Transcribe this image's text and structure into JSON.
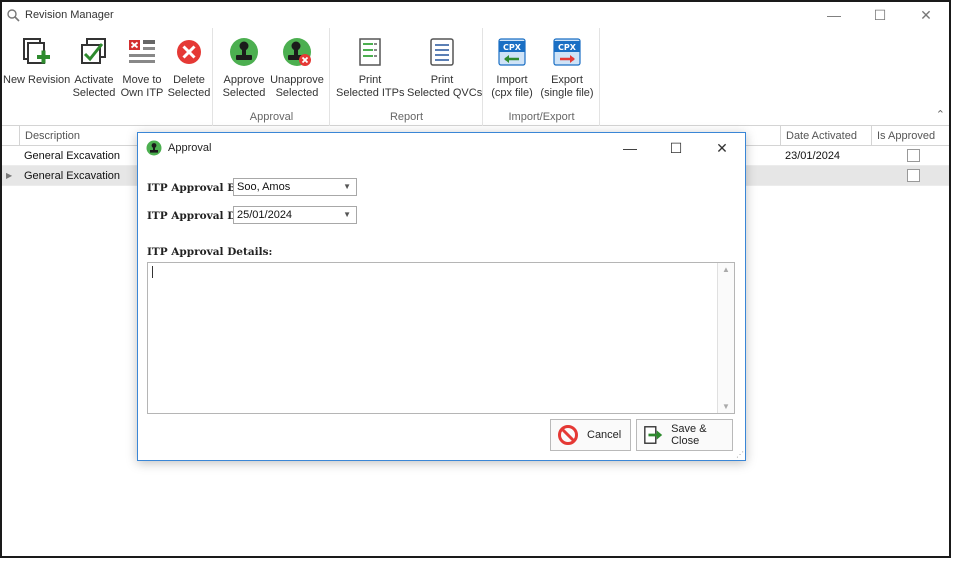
{
  "window": {
    "title": "Revision Manager",
    "controls": {
      "minimize": "—",
      "maximize": "☐",
      "close": "✕"
    }
  },
  "ribbon": {
    "groups": [
      {
        "id": "revision",
        "label": "",
        "buttons": [
          {
            "line1": "New Revision",
            "line2": "",
            "icon": "new-revision-icon"
          },
          {
            "line1": "Activate",
            "line2": "Selected",
            "icon": "activate-icon"
          },
          {
            "line1": "Move to",
            "line2": "Own ITP",
            "icon": "move-icon"
          },
          {
            "line1": "Delete",
            "line2": "Selected",
            "icon": "delete-icon"
          }
        ]
      },
      {
        "id": "approval",
        "label": "Approval",
        "buttons": [
          {
            "line1": "Approve",
            "line2": "Selected",
            "icon": "approve-stamp-icon"
          },
          {
            "line1": "Unapprove",
            "line2": "Selected",
            "icon": "unapprove-stamp-icon"
          }
        ]
      },
      {
        "id": "report",
        "label": "Report",
        "buttons": [
          {
            "line1": "Print",
            "line2": "Selected ITPs",
            "icon": "print-itp-icon"
          },
          {
            "line1": "Print",
            "line2": "Selected QVCs",
            "icon": "print-qvc-icon"
          }
        ]
      },
      {
        "id": "importexport",
        "label": "Import/Export",
        "buttons": [
          {
            "line1": "Import",
            "line2": "(cpx file)",
            "icon": "cpx-import-icon",
            "badge": "CPX"
          },
          {
            "line1": "Export",
            "line2": "(single file)",
            "icon": "cpx-export-icon",
            "badge": "CPX"
          }
        ]
      }
    ],
    "collapse_glyph": "⌃"
  },
  "grid": {
    "columns": {
      "description": "Description",
      "date_activated": "Date Activated",
      "is_approved": "Is Approved"
    },
    "rows": [
      {
        "description": "General Excavation",
        "date_activated": "23/01/2024",
        "is_approved": false
      },
      {
        "description": "General Excavation",
        "date_activated": "",
        "is_approved": false
      }
    ],
    "row_indicator": "▶"
  },
  "dialog": {
    "title": "Approval",
    "controls": {
      "minimize": "—",
      "maximize": "☐",
      "close": "✕"
    },
    "approval_by_label": "ITP Approval By:",
    "approval_by_value": "Soo, Amos",
    "approval_date_label": "ITP Approval Date:",
    "approval_date_value": "25/01/2024",
    "details_label": "ITP Approval Details:",
    "details_value": "",
    "cancel_label": "Cancel",
    "save_label": "Save & Close",
    "combo_arrow": "▼",
    "scroll_up": "▲",
    "scroll_down": "▼"
  },
  "colors": {
    "accent": "#3a86d6",
    "green": "#2e8b2e",
    "red": "#d32f2f",
    "cpx_blue": "#1a6fc4"
  }
}
